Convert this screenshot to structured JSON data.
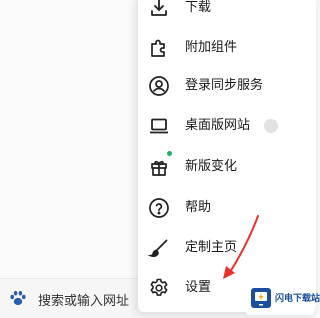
{
  "search_bar": {
    "icon": "paw-icon",
    "text": "搜索或输入网址"
  },
  "menu": {
    "items": [
      {
        "label": "下载",
        "icon": "download-icon"
      },
      {
        "label": "附加组件",
        "icon": "puzzle-icon"
      },
      {
        "label": "登录同步服务",
        "icon": "account-icon"
      },
      {
        "label": "桌面版网站",
        "icon": "laptop-icon",
        "toggle": "off"
      },
      {
        "label": "新版变化",
        "icon": "gift-icon",
        "badge": "new-dot"
      },
      {
        "label": "帮助",
        "icon": "help-icon"
      },
      {
        "label": "定制主页",
        "icon": "brush-icon"
      },
      {
        "label": "设置",
        "icon": "gear-icon"
      }
    ]
  },
  "watermark": {
    "text": "闪电下载站"
  },
  "colors": {
    "annotation_arrow": "#e8322b",
    "badge_dot": "#1fae6a",
    "paw_icon": "#2a5db0"
  }
}
